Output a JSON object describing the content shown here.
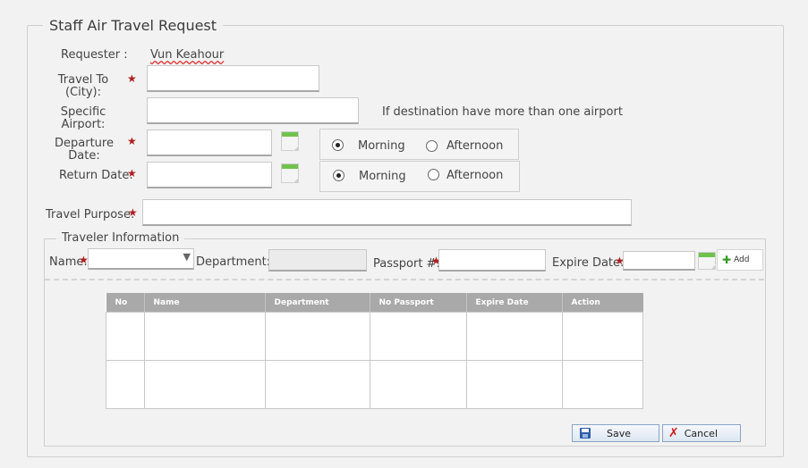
{
  "form": {
    "title": "Staff Air Travel Request",
    "requester_label": "Requester :",
    "requester_value": "Vun Keahour",
    "travel_to_label_1": "Travel To",
    "travel_to_label_2": "(City):",
    "specific_airport_label_1": "Specific",
    "specific_airport_label_2": "Airport:",
    "airport_hint": "If destination have more than one airport",
    "departure_date_label_1": "Departure",
    "departure_date_label_2": "Date:",
    "return_date_label": "Return Date:",
    "morning_label": "Morning",
    "afternoon_label": "Afternoon",
    "travel_purpose_label": "Travel Purpose:",
    "required_mark": "★"
  },
  "departure_time": "Morning",
  "return_time": "Morning",
  "traveler": {
    "section_title": "Traveler Information",
    "name_label": "Name:",
    "department_label": "Department:",
    "passport_label": "Passport #:",
    "expire_date_label": "Expire Date:",
    "add_label": "Add"
  },
  "table": {
    "columns": [
      "No",
      "Name",
      "Department",
      "No Passport",
      "Expire Date",
      "Action"
    ],
    "rows": [
      [
        "",
        "",
        "",
        "",
        "",
        ""
      ],
      [
        "",
        "",
        "",
        "",
        "",
        ""
      ]
    ]
  },
  "buttons": {
    "save_label": "Save",
    "cancel_label": "Cancel"
  },
  "icons": {
    "calendar": "calendar-icon",
    "dropdown": "dropdown-arrow-icon",
    "add": "plus-icon",
    "save": "floppy-disk-icon",
    "cancel": "red-x-icon"
  },
  "colors": {
    "required": "#b01e1e",
    "table_header": "#a9a9a9",
    "calendar_accent": "#6fc24c",
    "button_border": "#8aa4c4"
  }
}
